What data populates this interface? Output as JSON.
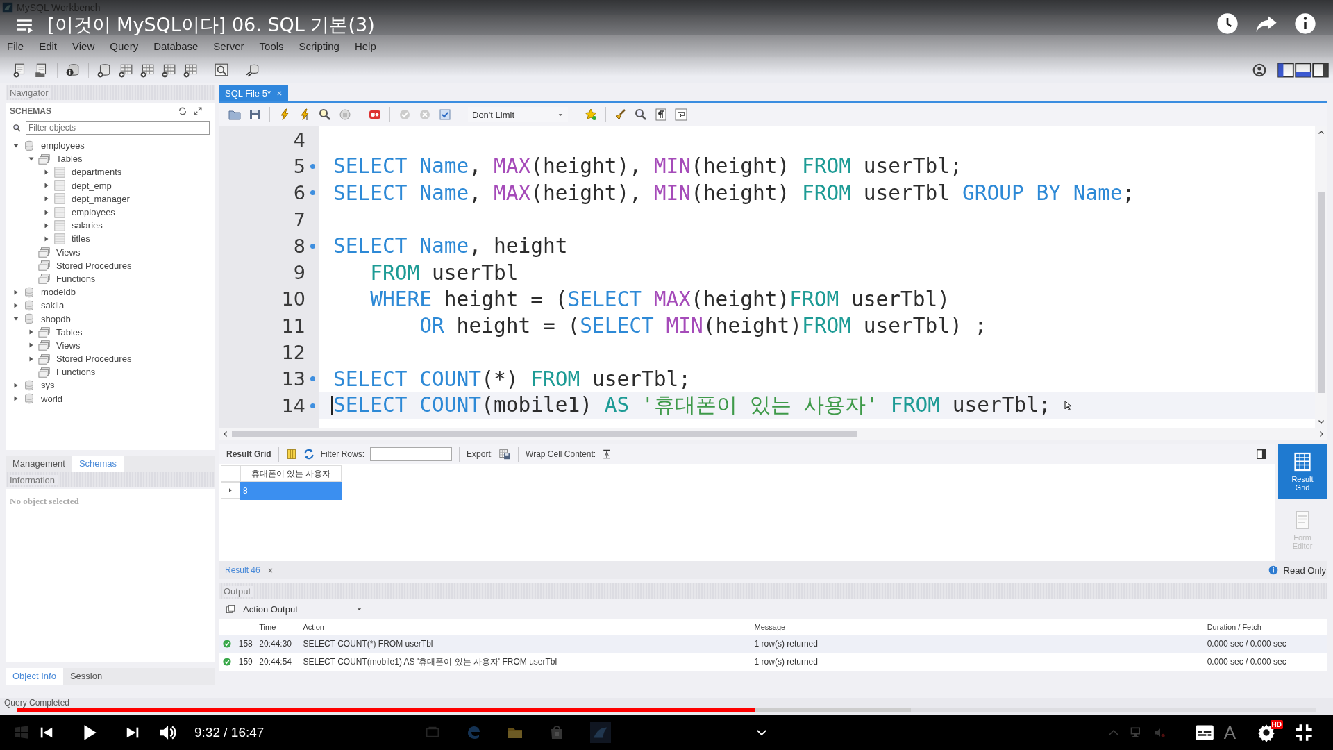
{
  "video": {
    "title": "[이것이 MySQL이다] 06. SQL 기본(3)",
    "time": "9:32 / 16:47",
    "quality_badge": "HD",
    "ime_indicator": "A",
    "progress": {
      "level": 0.568
    },
    "buffered": {
      "level": 0.688
    }
  },
  "window": {
    "title": "MySQL Workbench"
  },
  "menu": [
    "File",
    "Edit",
    "View",
    "Query",
    "Database",
    "Server",
    "Tools",
    "Scripting",
    "Help"
  ],
  "navigator": {
    "title": "Navigator",
    "section": "SCHEMAS",
    "filter": {
      "placeholder": "Filter objects"
    },
    "tree": [
      {
        "label": "employees",
        "kind": "schema",
        "expandable": true,
        "expanded": true,
        "children": [
          {
            "label": "Tables",
            "kind": "folder",
            "expandable": true,
            "expanded": true,
            "children": [
              {
                "label": "departments",
                "kind": "table",
                "expandable": true,
                "expanded": false
              },
              {
                "label": "dept_emp",
                "kind": "table",
                "expandable": true,
                "expanded": false
              },
              {
                "label": "dept_manager",
                "kind": "table",
                "expandable": true,
                "expanded": false
              },
              {
                "label": "employees",
                "kind": "table",
                "expandable": true,
                "expanded": false
              },
              {
                "label": "salaries",
                "kind": "table",
                "expandable": true,
                "expanded": false
              },
              {
                "label": "titles",
                "kind": "table",
                "expandable": true,
                "expanded": false
              }
            ]
          },
          {
            "label": "Views",
            "kind": "folder",
            "expandable": false,
            "expanded": false
          },
          {
            "label": "Stored Procedures",
            "kind": "folder",
            "expandable": false,
            "expanded": false
          },
          {
            "label": "Functions",
            "kind": "folder",
            "expandable": false,
            "expanded": false
          }
        ]
      },
      {
        "label": "modeldb",
        "kind": "schema",
        "expandable": true,
        "expanded": false
      },
      {
        "label": "sakila",
        "kind": "schema",
        "expandable": true,
        "expanded": false
      },
      {
        "label": "shopdb",
        "kind": "schema",
        "expandable": true,
        "expanded": true,
        "children": [
          {
            "label": "Tables",
            "kind": "folder",
            "expandable": true,
            "expanded": false
          },
          {
            "label": "Views",
            "kind": "folder",
            "expandable": true,
            "expanded": false
          },
          {
            "label": "Stored Procedures",
            "kind": "folder",
            "expandable": true,
            "expanded": false
          },
          {
            "label": "Functions",
            "kind": "folder",
            "expandable": false,
            "expanded": false
          }
        ]
      },
      {
        "label": "sys",
        "kind": "schema",
        "expandable": true,
        "expanded": false
      },
      {
        "label": "world",
        "kind": "schema",
        "expandable": true,
        "expanded": false
      }
    ]
  },
  "sidebar_tabs": [
    {
      "label": "Management",
      "selected": false
    },
    {
      "label": "Schemas",
      "selected": true
    }
  ],
  "information": {
    "title": "Information",
    "text": "No object selected"
  },
  "info_tabs": [
    {
      "label": "Object Info",
      "selected": true
    },
    {
      "label": "Session",
      "selected": false
    }
  ],
  "status_bar": "Query Completed",
  "editor": {
    "tabs": [
      {
        "label": "SQL File 5*",
        "selected": true
      }
    ],
    "limit": "Don't Limit",
    "lines": [
      {
        "number": "4",
        "marker": false,
        "current": false
      },
      {
        "number": "5",
        "marker": true,
        "current": false,
        "tokens": [
          {
            "text": "SELECT",
            "kind": "kw"
          },
          {
            "text": " Name",
            "kind": "kw"
          },
          {
            "text": ", ",
            "kind": "plain"
          },
          {
            "text": "MAX",
            "kind": "fn"
          },
          {
            "text": "(height), ",
            "kind": "plain"
          },
          {
            "text": "MIN",
            "kind": "fn"
          },
          {
            "text": "(height) ",
            "kind": "plain"
          },
          {
            "text": "FROM",
            "kind": "kw2"
          },
          {
            "text": " userTbl;",
            "kind": "plain"
          }
        ]
      },
      {
        "number": "6",
        "marker": true,
        "current": false,
        "tokens": [
          {
            "text": "SELECT",
            "kind": "kw"
          },
          {
            "text": " Name",
            "kind": "kw"
          },
          {
            "text": ", ",
            "kind": "plain"
          },
          {
            "text": "MAX",
            "kind": "fn"
          },
          {
            "text": "(height), ",
            "kind": "plain"
          },
          {
            "text": "MIN",
            "kind": "fn"
          },
          {
            "text": "(height) ",
            "kind": "plain"
          },
          {
            "text": "FROM",
            "kind": "kw2"
          },
          {
            "text": " userTbl ",
            "kind": "plain"
          },
          {
            "text": "GROUP BY Name",
            "kind": "kw"
          },
          {
            "text": ";",
            "kind": "plain"
          }
        ]
      },
      {
        "number": "7",
        "marker": false,
        "current": false
      },
      {
        "number": "8",
        "marker": true,
        "current": false,
        "tokens": [
          {
            "text": "SELECT",
            "kind": "kw"
          },
          {
            "text": " Name",
            "kind": "kw"
          },
          {
            "text": ", height",
            "kind": "plain"
          }
        ]
      },
      {
        "number": "9",
        "marker": false,
        "current": false,
        "tokens": [
          {
            "text": "   FROM",
            "kind": "kw2"
          },
          {
            "text": " userTbl",
            "kind": "plain"
          }
        ]
      },
      {
        "number": "10",
        "marker": false,
        "current": false,
        "tokens": [
          {
            "text": "   WHERE",
            "kind": "kw"
          },
          {
            "text": " height = (",
            "kind": "plain"
          },
          {
            "text": "SELECT ",
            "kind": "kw"
          },
          {
            "text": "MAX",
            "kind": "fn"
          },
          {
            "text": "(height)",
            "kind": "plain"
          },
          {
            "text": "FROM",
            "kind": "kw2"
          },
          {
            "text": " userTbl)",
            "kind": "plain"
          }
        ]
      },
      {
        "number": "11",
        "marker": false,
        "current": false,
        "tokens": [
          {
            "text": "       OR",
            "kind": "kw"
          },
          {
            "text": " height = (",
            "kind": "plain"
          },
          {
            "text": "SELECT ",
            "kind": "kw"
          },
          {
            "text": "MIN",
            "kind": "fn"
          },
          {
            "text": "(height)",
            "kind": "plain"
          },
          {
            "text": "FROM",
            "kind": "kw2"
          },
          {
            "text": " userTbl) ;",
            "kind": "plain"
          }
        ]
      },
      {
        "number": "12",
        "marker": false,
        "current": false
      },
      {
        "number": "13",
        "marker": true,
        "current": false,
        "tokens": [
          {
            "text": "SELECT COUNT",
            "kind": "kw"
          },
          {
            "text": "(*) ",
            "kind": "plain"
          },
          {
            "text": "FROM",
            "kind": "kw2"
          },
          {
            "text": " userTbl;",
            "kind": "plain"
          }
        ]
      },
      {
        "number": "14",
        "marker": true,
        "current": true,
        "tokens": [
          {
            "text": "SELECT COUNT",
            "kind": "kw"
          },
          {
            "text": "(mobile1) ",
            "kind": "plain"
          },
          {
            "text": "AS ",
            "kind": "kw2"
          },
          {
            "text": "'휴대폰이 있는 사용자'",
            "kind": "str"
          },
          {
            "text": " FROM",
            "kind": "kw2"
          },
          {
            "text": " userTbl;",
            "kind": "plain"
          }
        ]
      }
    ]
  },
  "result": {
    "grid_label": "Result Grid",
    "filter_label": "Filter Rows:",
    "export_label": "Export:",
    "wrap_label": "Wrap Cell Content:",
    "columns": [
      "휴대폰이 있는 사용자"
    ],
    "rows": [
      {
        "cells": [
          "8"
        ],
        "selected": true
      }
    ],
    "side_buttons": [
      {
        "label": "Result Grid",
        "selected": true
      },
      {
        "label": "Form Editor",
        "selected": false
      }
    ],
    "tabs": [
      {
        "label": "Result 46",
        "selected": true
      }
    ],
    "read_only": "Read Only"
  },
  "output": {
    "title": "Output",
    "mode": "Action Output",
    "columns": [
      "Time",
      "Action",
      "Message",
      "Duration / Fetch"
    ],
    "rows": [
      {
        "success": true,
        "number": "158",
        "time": "20:44:30",
        "action": "SELECT COUNT(*) FROM userTbl",
        "message": "1 row(s) returned",
        "duration": "0.000 sec / 0.000 sec"
      },
      {
        "success": true,
        "number": "159",
        "time": "20:44:54",
        "action": "SELECT COUNT(mobile1) AS '휴대폰이 있는 사용자' FROM userTbl",
        "message": "1 row(s) returned",
        "duration": "0.000 sec / 0.000 sec"
      }
    ]
  }
}
